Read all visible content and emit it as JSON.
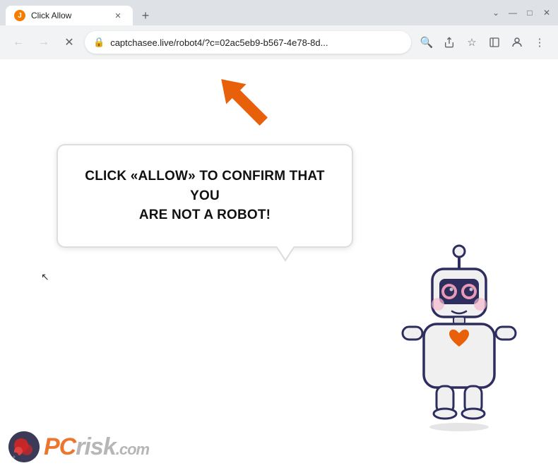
{
  "browser": {
    "tab": {
      "title": "Click Allow",
      "icon": "J"
    },
    "new_tab_label": "+",
    "window_controls": {
      "minimize": "—",
      "maximize": "□",
      "close": "✕"
    },
    "nav": {
      "back": "←",
      "forward": "→",
      "refresh": "✕"
    },
    "address": {
      "url": "captchasee.live/robot4/?c=02ac5eb9-b567-4e78-8d...",
      "lock_icon": "🔒"
    },
    "toolbar_icons": {
      "search": "🔍",
      "share": "⬆",
      "bookmark": "☆",
      "sidebar": "▣",
      "profile": "👤",
      "menu": "⋮"
    }
  },
  "page": {
    "bubble_line1": "CLICK «ALLOW» TO CONFIRM THAT YOU",
    "bubble_line2": "ARE NOT A ROBOT!",
    "pcrisk": {
      "text": "PC",
      "risk": "risk",
      "dotcom": ".com"
    }
  }
}
